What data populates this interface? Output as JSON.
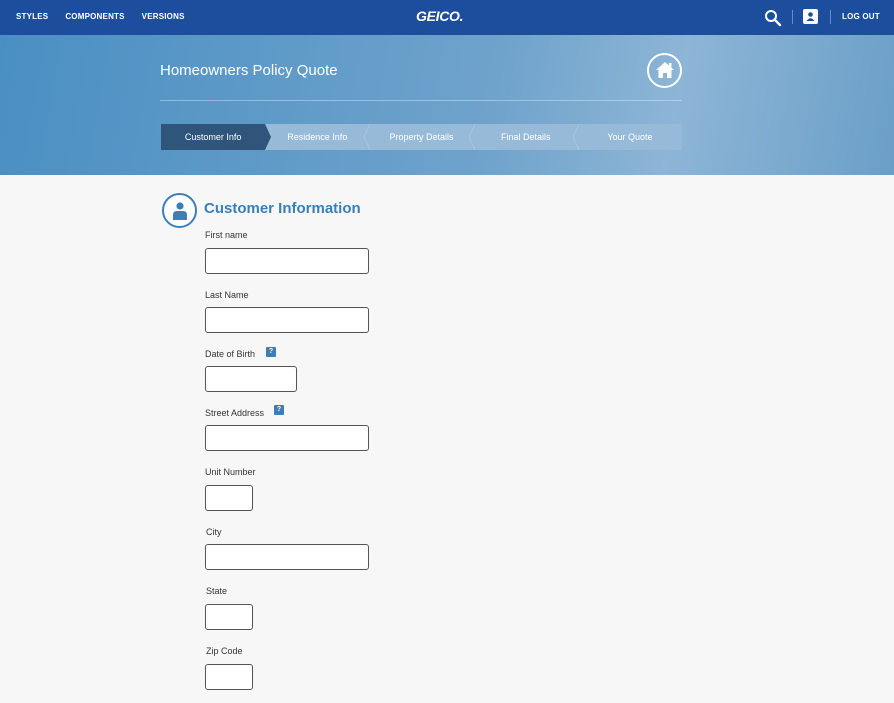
{
  "nav": {
    "links": [
      "STYLES",
      "COMPONENTS",
      "VERSIONS"
    ],
    "logo": "GEICO.",
    "logout": "LOG OUT"
  },
  "hero": {
    "title": "Homeowners Policy Quote"
  },
  "steps": [
    "Customer Info",
    "Residence Info",
    "Property Details",
    "Final Details",
    "Your Quote"
  ],
  "active_step": "Customer Info",
  "section": {
    "title": "Customer Information"
  },
  "form": {
    "first_name": {
      "label": "First name",
      "value": ""
    },
    "last_name": {
      "label": "Last Name",
      "value": ""
    },
    "dob": {
      "label": "Date of Birth",
      "value": "",
      "help": "?"
    },
    "street": {
      "label": "Street Address",
      "value": "",
      "help": "?"
    },
    "unit": {
      "label": "Unit Number",
      "value": ""
    },
    "city": {
      "label": "City",
      "value": ""
    },
    "state": {
      "label": "State",
      "value": ""
    },
    "zip": {
      "label": "Zip Code",
      "value": ""
    }
  },
  "colors": {
    "nav_bg": "#1d4e9e",
    "accent": "#3a7fb8",
    "active_step": "#2f557a",
    "step_bg": "#97bad9"
  },
  "icons": [
    "search-icon",
    "user-icon",
    "home-icon",
    "person-icon",
    "help-icon"
  ]
}
